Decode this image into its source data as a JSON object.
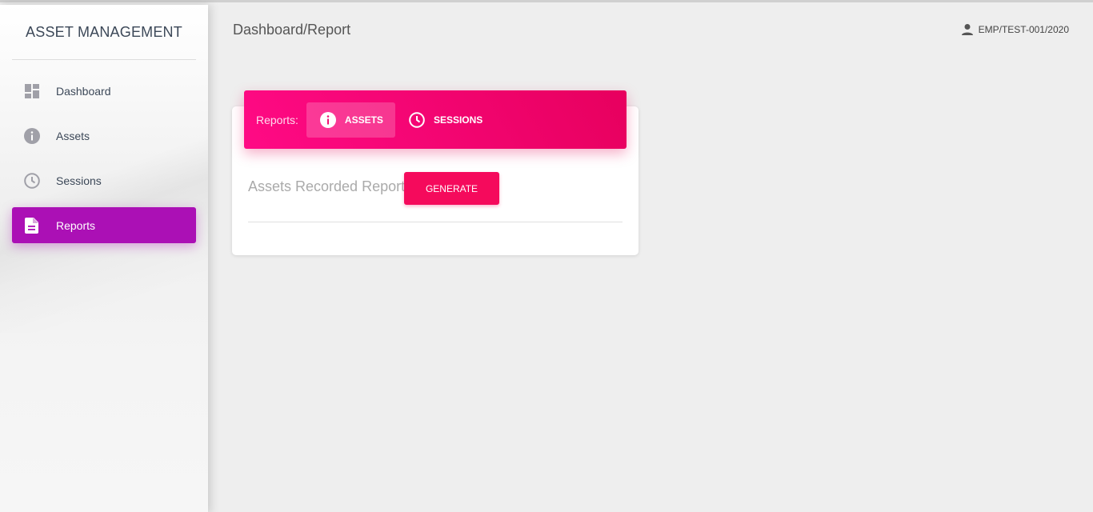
{
  "sidebar": {
    "logo": "ASSET MANAGEMENT",
    "items": [
      {
        "label": "Dashboard",
        "icon": "dashboard-icon"
      },
      {
        "label": "Assets",
        "icon": "info-icon"
      },
      {
        "label": "Sessions",
        "icon": "clock-icon"
      },
      {
        "label": "Reports",
        "icon": "document-icon"
      }
    ],
    "active_color": "#ab10b5"
  },
  "header": {
    "title": "Dashboard/Report",
    "user_id": "EMP/TEST-001/2020",
    "user_icon": "person-icon"
  },
  "reports": {
    "tabs_label": "Reports:",
    "tabs": [
      {
        "label": "ASSETS",
        "icon": "info-icon",
        "active": true
      },
      {
        "label": "SESSIONS",
        "icon": "clock-icon",
        "active": false
      }
    ],
    "report_title": "Assets Recorded Report",
    "generate_label": "GENERATE",
    "accent_color": "#e91e63"
  }
}
